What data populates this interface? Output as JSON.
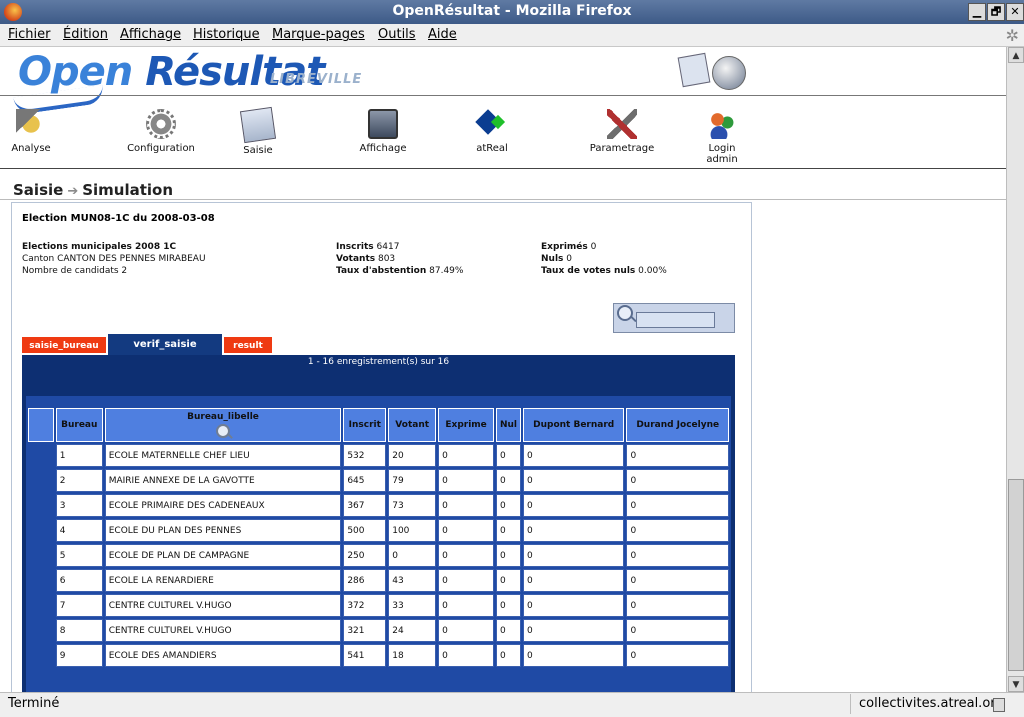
{
  "window": {
    "title": "OpenRésultat - Mozilla Firefox",
    "min": "▁",
    "max": "🗗",
    "close": "✕"
  },
  "menu": [
    "Fichier",
    "Édition",
    "Affichage",
    "Historique",
    "Marque-pages",
    "Outils",
    "Aide"
  ],
  "logo": {
    "open": "Open",
    "resultat": "Résultat",
    "city": "LIBREVILLE"
  },
  "toolbar": [
    {
      "label": "Analyse",
      "icon": "analyse-icon"
    },
    {
      "label": "Configuration",
      "icon": "gear-icon"
    },
    {
      "label": "Saisie",
      "icon": "saisie-icon"
    },
    {
      "label": "Affichage",
      "icon": "monitor-icon"
    },
    {
      "label": "atReal",
      "icon": "atreal-icon"
    },
    {
      "label": "Parametrage",
      "icon": "tools-icon"
    },
    {
      "label": "Login admin",
      "icon": "users-icon"
    }
  ],
  "breadcrumb": {
    "section": "Saisie",
    "page": "Simulation"
  },
  "election": {
    "title": "Election MUN08-1C du 2008-03-08",
    "name": "Elections municipales 2008 1C",
    "canton": "Canton CANTON DES PENNES MIRABEAU",
    "candidates": "Nombre de candidats 2",
    "inscrits_label": "Inscrits",
    "inscrits": "6417",
    "votants_label": "Votants",
    "votants": "803",
    "abstention_label": "Taux d'abstention",
    "abstention": "87.49%",
    "exprimes_label": "Exprimés",
    "exprimes": "0",
    "nuls_label": "Nuls",
    "nuls": "0",
    "nuls_taux_label": "Taux de votes nuls",
    "nuls_taux": "0.00%"
  },
  "search": {
    "value": ""
  },
  "tabs": [
    "saisie_bureau",
    "verif_saisie",
    "result"
  ],
  "active_tab": "verif_saisie",
  "records": "1 - 16 enregistrement(s) sur 16",
  "table": {
    "columns": [
      "Bureau",
      "Bureau_libelle",
      "Inscrit",
      "Votant",
      "Exprime",
      "Nul",
      "Dupont Bernard",
      "Durand Jocelyne"
    ],
    "rows": [
      [
        "1",
        "ECOLE MATERNELLE CHEF LIEU",
        "532",
        "20",
        "0",
        "0",
        "0",
        "0"
      ],
      [
        "2",
        "MAIRIE ANNEXE DE LA GAVOTTE",
        "645",
        "79",
        "0",
        "0",
        "0",
        "0"
      ],
      [
        "3",
        "ECOLE PRIMAIRE DES CADENEAUX",
        "367",
        "73",
        "0",
        "0",
        "0",
        "0"
      ],
      [
        "4",
        "ECOLE DU PLAN DES PENNES",
        "500",
        "100",
        "0",
        "0",
        "0",
        "0"
      ],
      [
        "5",
        "ECOLE DE PLAN DE CAMPAGNE",
        "250",
        "0",
        "0",
        "0",
        "0",
        "0"
      ],
      [
        "6",
        "ECOLE LA RENARDIERE",
        "286",
        "43",
        "0",
        "0",
        "0",
        "0"
      ],
      [
        "7",
        "CENTRE CULTUREL V.HUGO",
        "372",
        "33",
        "0",
        "0",
        "0",
        "0"
      ],
      [
        "8",
        "CENTRE CULTUREL V.HUGO",
        "321",
        "24",
        "0",
        "0",
        "0",
        "0"
      ],
      [
        "9",
        "ECOLE DES AMANDIERS",
        "541",
        "18",
        "0",
        "0",
        "0",
        "0"
      ]
    ]
  },
  "status": {
    "left": "Terminé",
    "right": "collectivites.atreal.org"
  }
}
